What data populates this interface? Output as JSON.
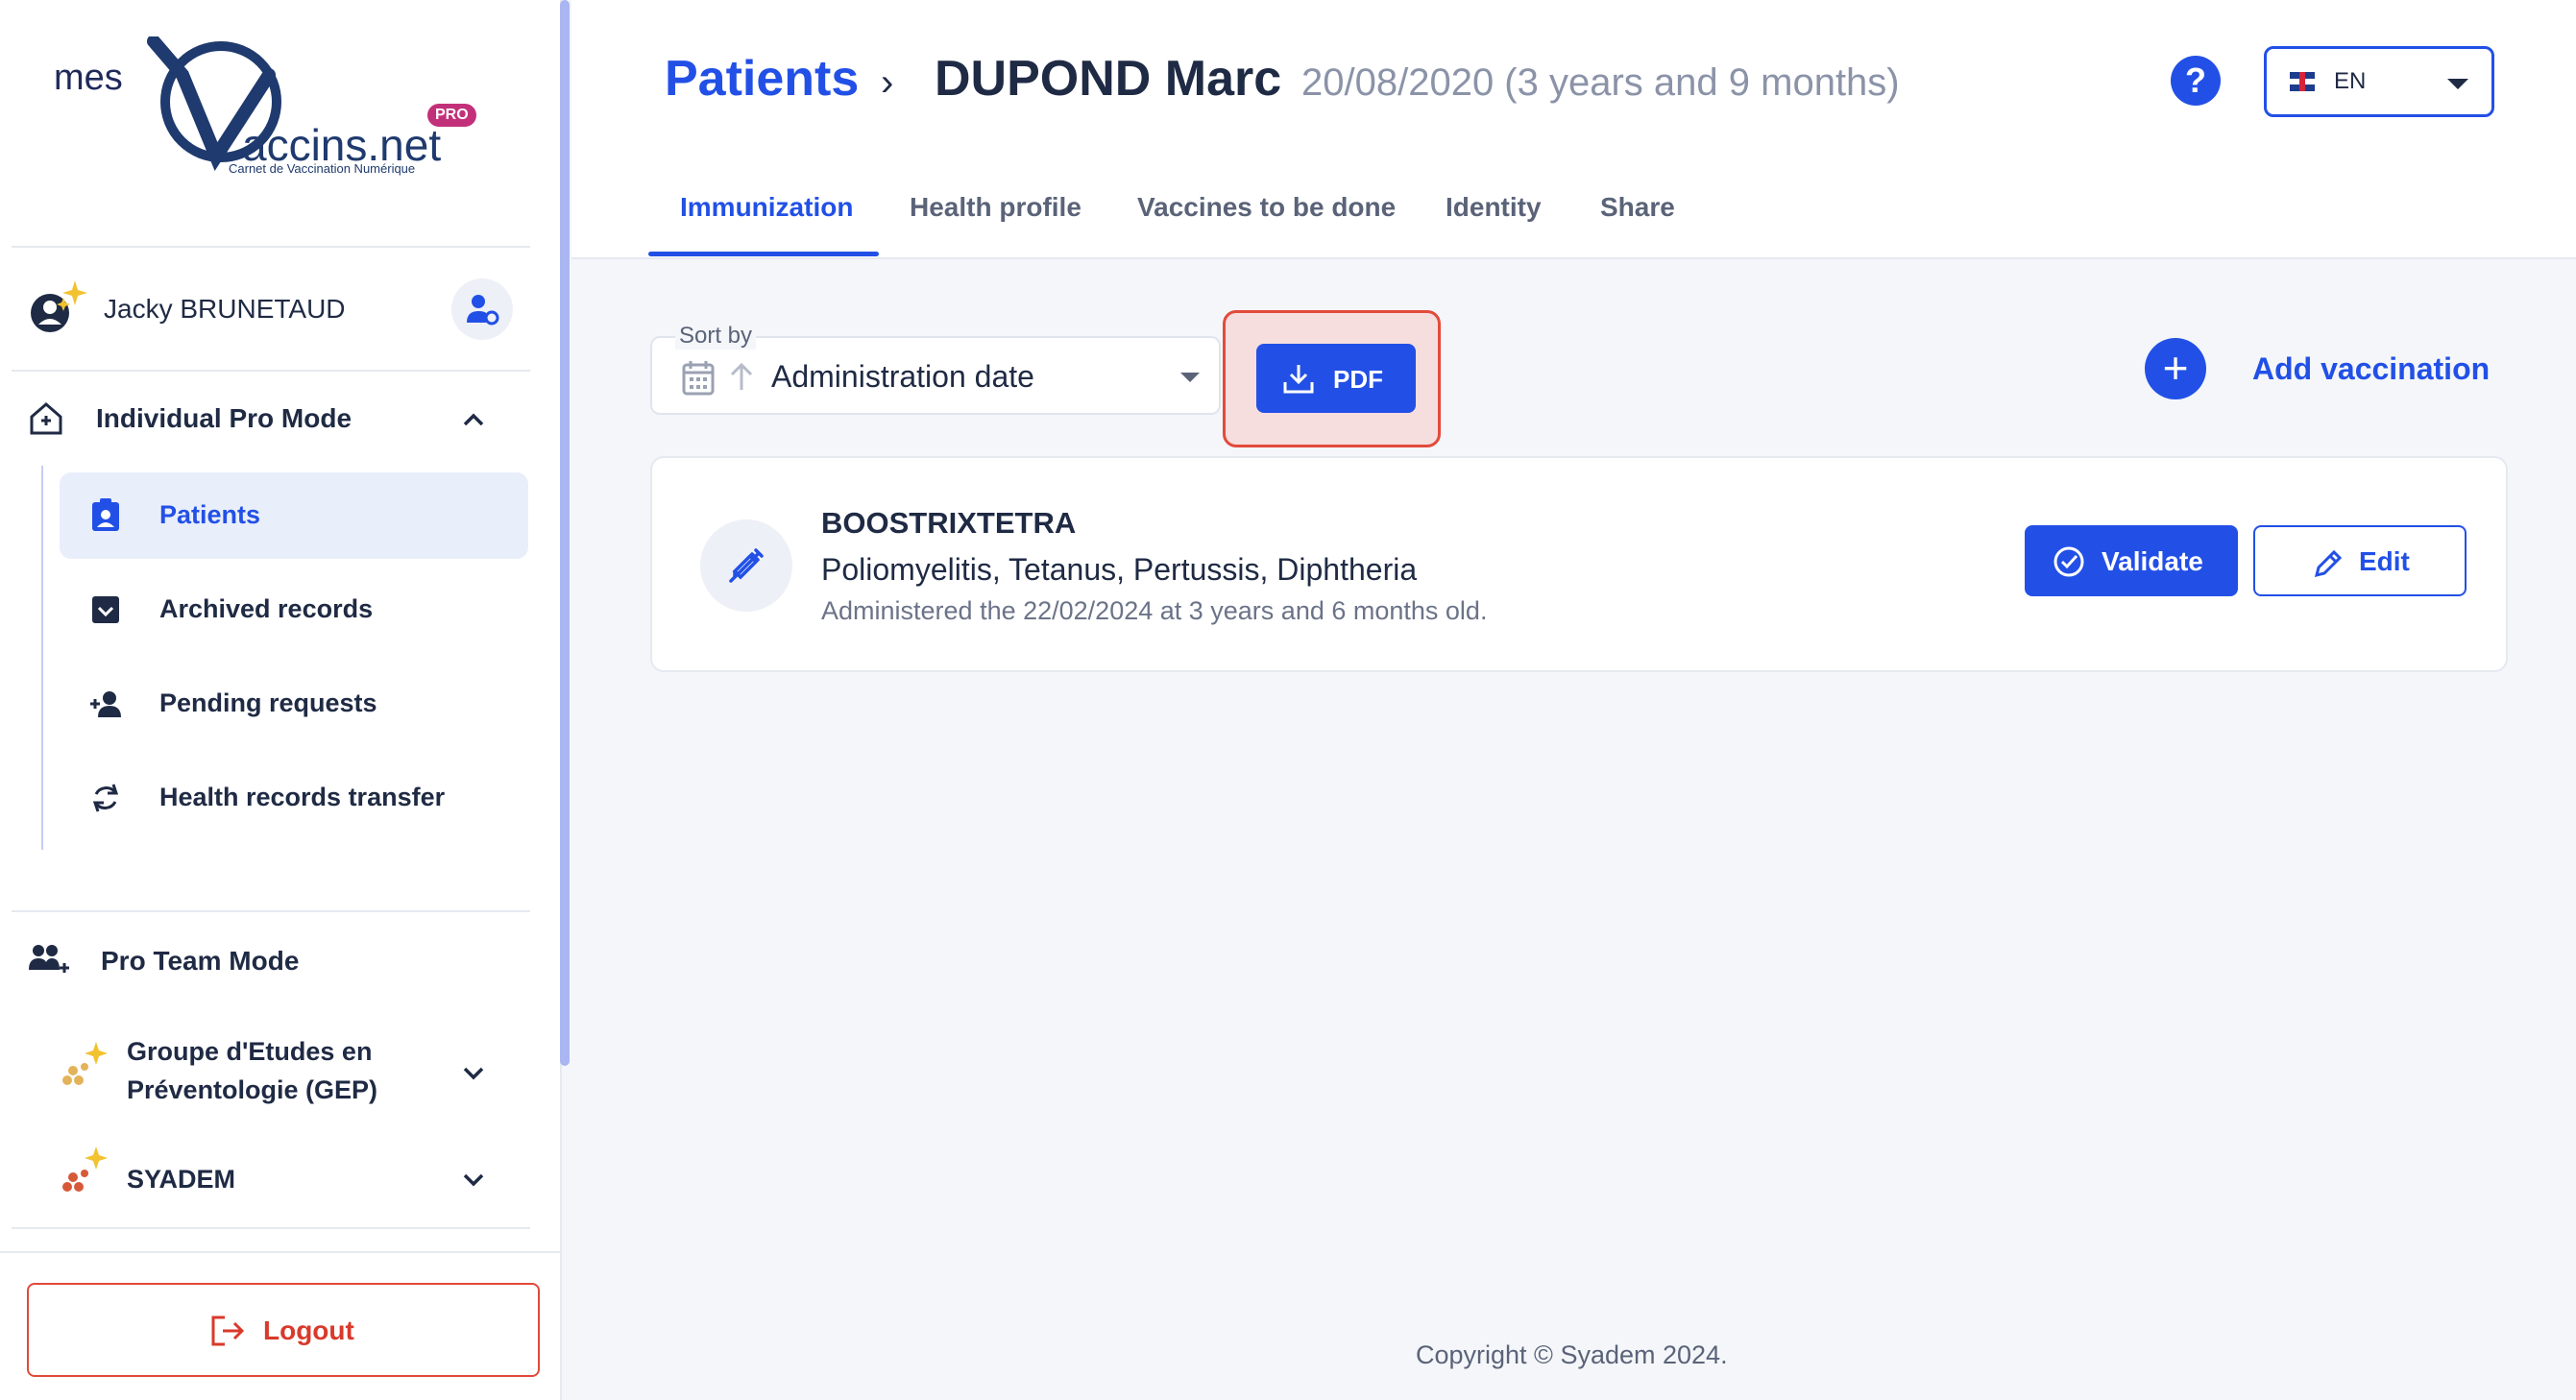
{
  "brand": {
    "prefix": "mes",
    "name": "accins.net",
    "tagline": "Carnet de Vaccination Numérique",
    "badge": "PRO"
  },
  "user": {
    "name": "Jacky BRUNETAUD"
  },
  "sidebar": {
    "individual_mode": "Individual Pro Mode",
    "items": [
      {
        "label": "Patients",
        "icon": "patients-icon"
      },
      {
        "label": "Archived records",
        "icon": "archive-icon"
      },
      {
        "label": "Pending requests",
        "icon": "add-person-icon"
      },
      {
        "label": "Health records transfer",
        "icon": "sync-icon"
      }
    ],
    "team_mode": "Pro Team Mode",
    "teams": [
      {
        "label_line1": "Groupe d'Etudes en",
        "label_line2": "Préventologie (GEP)"
      },
      {
        "label": "SYADEM"
      }
    ],
    "logout": "Logout"
  },
  "header": {
    "breadcrumb_link": "Patients",
    "separator": "›",
    "patient_name": "DUPOND Marc",
    "birth_info": "20/08/2020 (3 years and 9 months)",
    "help": "?",
    "language": "EN"
  },
  "tabs": [
    "Immunization",
    "Health profile",
    "Vaccines to be done",
    "Identity",
    "Share"
  ],
  "toolbar": {
    "sort_label": "Sort by",
    "sort_value": "Administration date",
    "pdf_label": "PDF",
    "add_label": "Add vaccination",
    "add_symbol": "+"
  },
  "vaccination": {
    "name": "BOOSTRIXTETRA",
    "diseases": "Poliomyelitis, Tetanus, Pertussis, Diphtheria",
    "administered": "Administered the 22/02/2024 at 3 years and 6 months old.",
    "validate_label": "Validate",
    "edit_label": "Edit"
  },
  "footer": "Copyright © Syadem 2024.",
  "colors": {
    "accent": "#2250e6",
    "danger": "#d83a2b",
    "highlight": "#f5dedd"
  }
}
